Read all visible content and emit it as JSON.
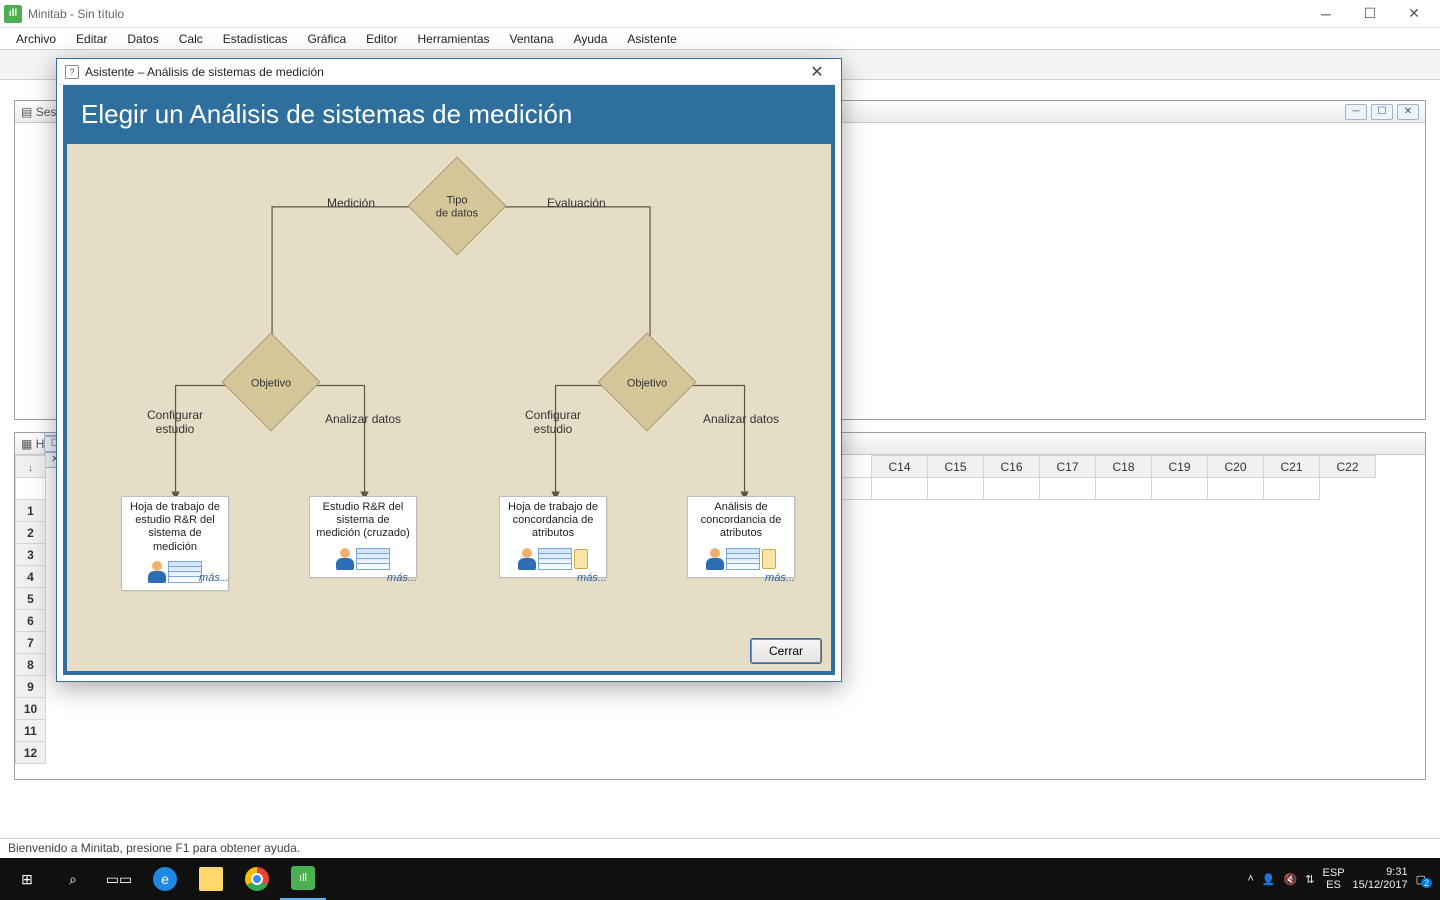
{
  "window": {
    "title": "Minitab - Sin título"
  },
  "menu": {
    "items": [
      "Archivo",
      "Editar",
      "Datos",
      "Calc",
      "Estadísticas",
      "Gráfica",
      "Editor",
      "Herramientas",
      "Ventana",
      "Ayuda",
      "Asistente"
    ]
  },
  "session_window": {
    "title": "Sesi"
  },
  "worksheet_window": {
    "title": "H",
    "columns": [
      "C14",
      "C15",
      "C16",
      "C17",
      "C18",
      "C19",
      "C20",
      "C21",
      "C22"
    ],
    "row_headers": [
      "1",
      "2",
      "3",
      "4",
      "5",
      "6",
      "7",
      "8",
      "9",
      "10",
      "11",
      "12"
    ]
  },
  "dialog": {
    "title": "Asistente – Análisis de sistemas de medición",
    "heading": "Elegir un Análisis de sistemas de medición",
    "root_diamond": "Tipo\nde datos",
    "branch_left": "Medición",
    "branch_right": "Evaluación",
    "objective_label": "Objetivo",
    "sub_left": "Configurar\nestudio",
    "sub_right": "Analizar datos",
    "cards": {
      "c1": "Hoja de trabajo de estudio R&R del sistema de medición",
      "c2": "Estudio R&R del sistema de medición (cruzado)",
      "c3": "Hoja de trabajo de concordancia de atributos",
      "c4": "Análisis de concordancia de atributos"
    },
    "more": "más...",
    "close_btn": "Cerrar"
  },
  "status": {
    "text": "Bienvenido a Minitab, presione F1 para obtener ayuda."
  },
  "taskbar": {
    "lang": "ESP",
    "kbd": "ES",
    "time": "9:31",
    "date": "15/12/2017",
    "notif": "2"
  }
}
